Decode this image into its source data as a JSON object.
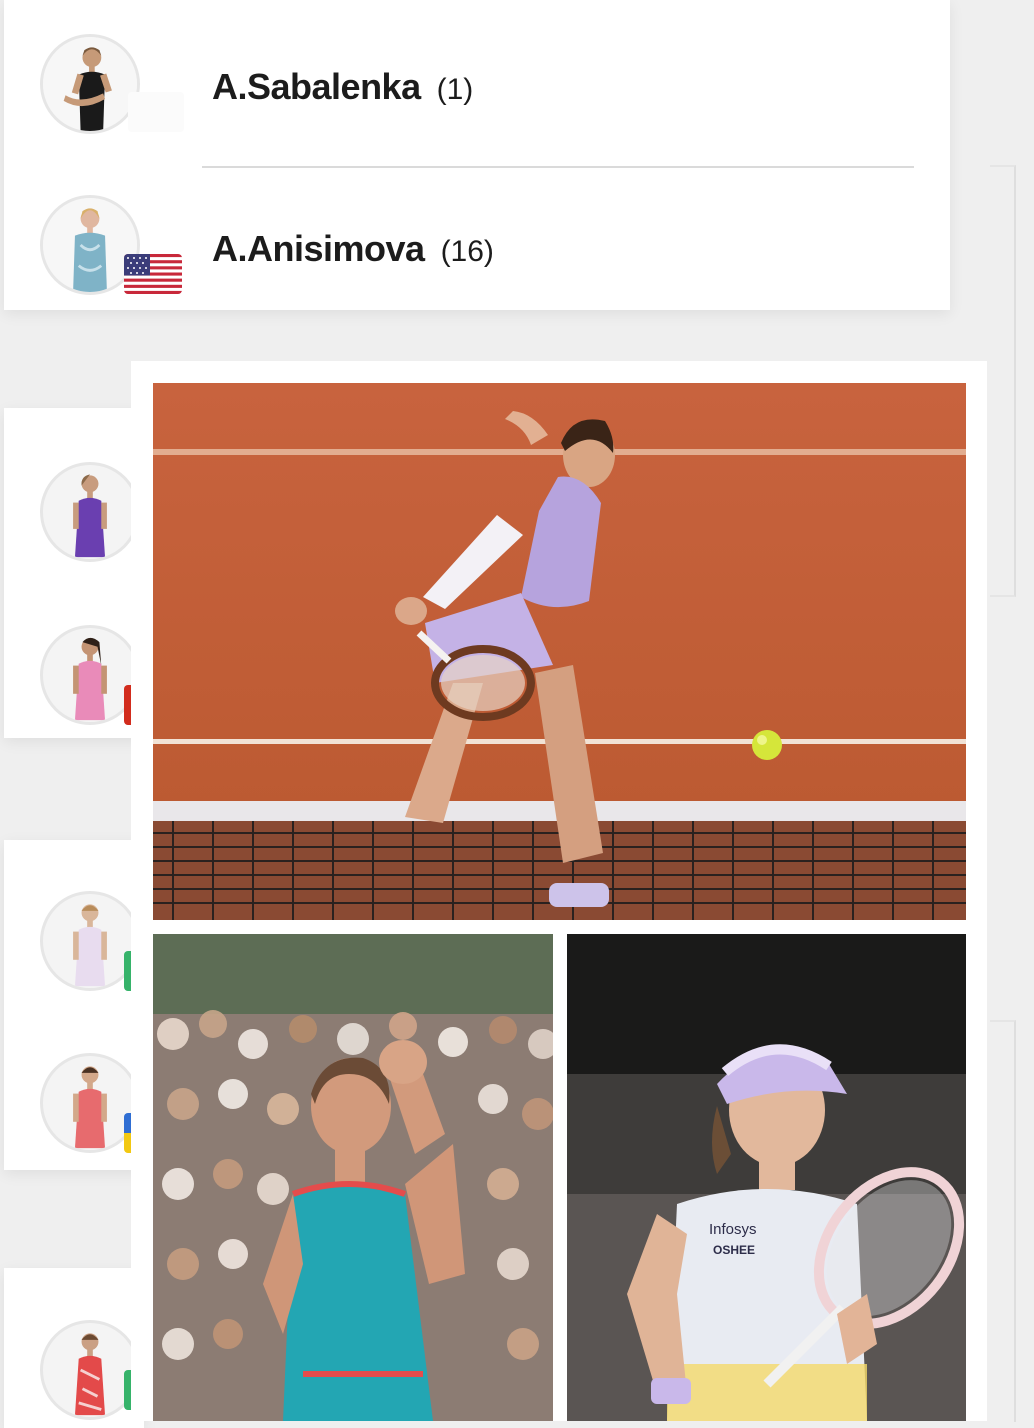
{
  "colors": {
    "card_bg": "#ffffff",
    "page_bg": "#efefef",
    "text": "#1c1c1c",
    "divider": "#dadada",
    "clay": "#c4613a",
    "lavender": "#b6a3dd",
    "teal": "#23a6b3"
  },
  "match": {
    "players": [
      {
        "name": "A.Sabalenka",
        "seed": "(1)",
        "avatar_icon": "player-avatar-icon",
        "flag": null
      },
      {
        "name": "A.Anisimova",
        "seed": "(16)",
        "avatar_icon": "player-avatar-icon",
        "flag": "us-flag-icon"
      }
    ]
  },
  "bracket_side_avatars": [
    {
      "icon": "player-avatar-icon",
      "outfit": "#6a3fb0"
    },
    {
      "icon": "player-avatar-icon",
      "outfit": "#e98bb9",
      "chip": "#d22c1d"
    },
    {
      "icon": "player-avatar-icon",
      "outfit": "#e8dcef",
      "chip": "#36b36a"
    },
    {
      "icon": "player-avatar-icon",
      "outfit": "#e76b6e",
      "chip": "#f2c812"
    },
    {
      "icon": "player-avatar-icon",
      "outfit": "#e34a4a",
      "chip": "#36b36a"
    }
  ],
  "gallery": {
    "photos": [
      {
        "icon": "tennis-photo-icon",
        "subject": "player-volley-on-clay"
      },
      {
        "icon": "tennis-photo-icon",
        "subject": "player-fist-pump"
      },
      {
        "icon": "tennis-photo-icon",
        "subject": "player-with-racket"
      }
    ],
    "shirt_text": [
      "Infosys",
      "OSHEE"
    ]
  }
}
